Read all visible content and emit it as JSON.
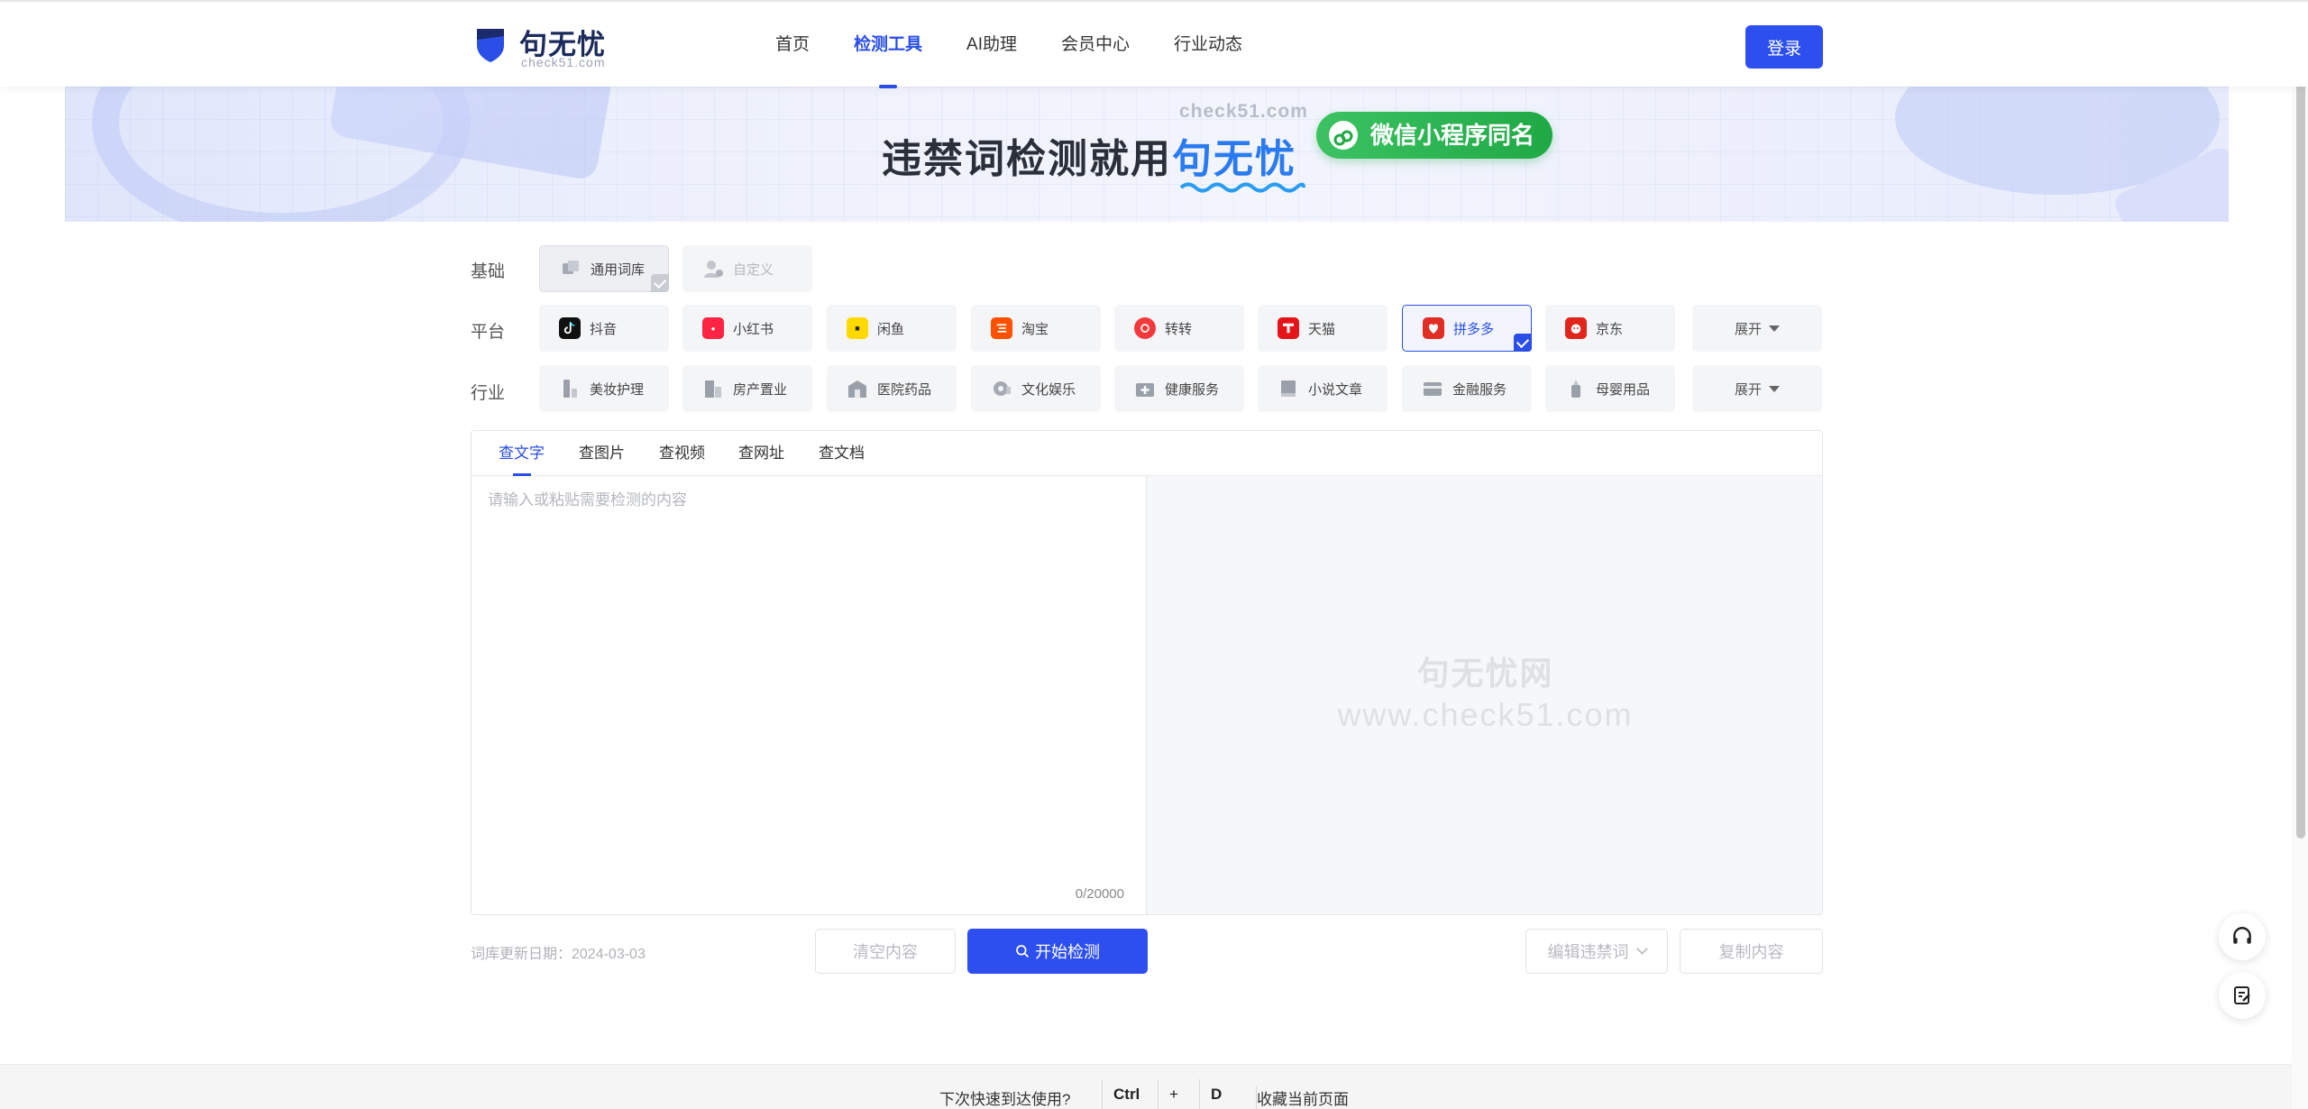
{
  "header": {
    "logo_name": "句无忧",
    "logo_sub": "check51.com",
    "nav": [
      {
        "label": "首页",
        "active": false
      },
      {
        "label": "检测工具",
        "active": true
      },
      {
        "label": "AI助理",
        "active": false
      },
      {
        "label": "会员中心",
        "active": false
      },
      {
        "label": "行业动态",
        "active": false
      }
    ],
    "login_label": "登录"
  },
  "banner": {
    "domain": "check51.com",
    "slogan_prefix": "违禁词检测就用",
    "slogan_brand": "句无忧",
    "mini_program": "微信小程序同名"
  },
  "filters": {
    "basic": {
      "label": "基础",
      "items": [
        {
          "label": "通用词库",
          "icon": "library-icon",
          "selected": true
        },
        {
          "label": "自定义",
          "icon": "user-settings-icon",
          "disabled": true
        }
      ]
    },
    "platform": {
      "label": "平台",
      "items": [
        {
          "label": "抖音",
          "icon": "douyin-icon",
          "color": "#111111"
        },
        {
          "label": "小红书",
          "icon": "xiaohongshu-icon",
          "color": "#ff2442"
        },
        {
          "label": "闲鱼",
          "icon": "xianyu-icon",
          "color": "#ffd900"
        },
        {
          "label": "淘宝",
          "icon": "taobao-icon",
          "color": "#ff5000"
        },
        {
          "label": "转转",
          "icon": "zhuanzhuan-icon",
          "color": "#f23a3c"
        },
        {
          "label": "天猫",
          "icon": "tmall-icon",
          "color": "#e5141b"
        },
        {
          "label": "拼多多",
          "icon": "pinduoduo-icon",
          "color": "#e02e24",
          "selected": true
        },
        {
          "label": "京东",
          "icon": "jd-icon",
          "color": "#e1251b"
        }
      ],
      "more_label": "展开"
    },
    "industry": {
      "label": "行业",
      "items": [
        {
          "label": "美妆护理",
          "icon": "cosmetics-icon"
        },
        {
          "label": "房产置业",
          "icon": "building-icon"
        },
        {
          "label": "医院药品",
          "icon": "hospital-icon"
        },
        {
          "label": "文化娱乐",
          "icon": "entertainment-icon"
        },
        {
          "label": "健康服务",
          "icon": "medical-kit-icon"
        },
        {
          "label": "小说文章",
          "icon": "book-icon"
        },
        {
          "label": "金融服务",
          "icon": "card-icon"
        },
        {
          "label": "母婴用品",
          "icon": "baby-bottle-icon"
        }
      ],
      "more_label": "展开"
    }
  },
  "editor": {
    "tabs": [
      {
        "label": "查文字",
        "active": true
      },
      {
        "label": "查图片",
        "active": false
      },
      {
        "label": "查视频",
        "active": false
      },
      {
        "label": "查网址",
        "active": false
      },
      {
        "label": "查文档",
        "active": false
      }
    ],
    "placeholder": "请输入或粘贴需要检测的内容",
    "value": "",
    "counter": "0/20000",
    "watermark_line1": "句无忧网",
    "watermark_line2": "www.check51.com"
  },
  "actions": {
    "update_date": "词库更新日期：2024-03-03",
    "clear_label": "清空内容",
    "start_label": "开始检测",
    "edit_label": "编辑违禁词",
    "copy_label": "复制内容"
  },
  "bottom_bar": {
    "prompt": "下次快速到达使用?",
    "key1": "Ctrl",
    "plus": "+",
    "key2": "D",
    "bookmark": "收藏当前页面"
  },
  "colors": {
    "accent": "#2e4ff0",
    "active_text": "#2a4ee6",
    "brand_blue": "#2a7bf0",
    "wechat_green": "#1fa945"
  }
}
